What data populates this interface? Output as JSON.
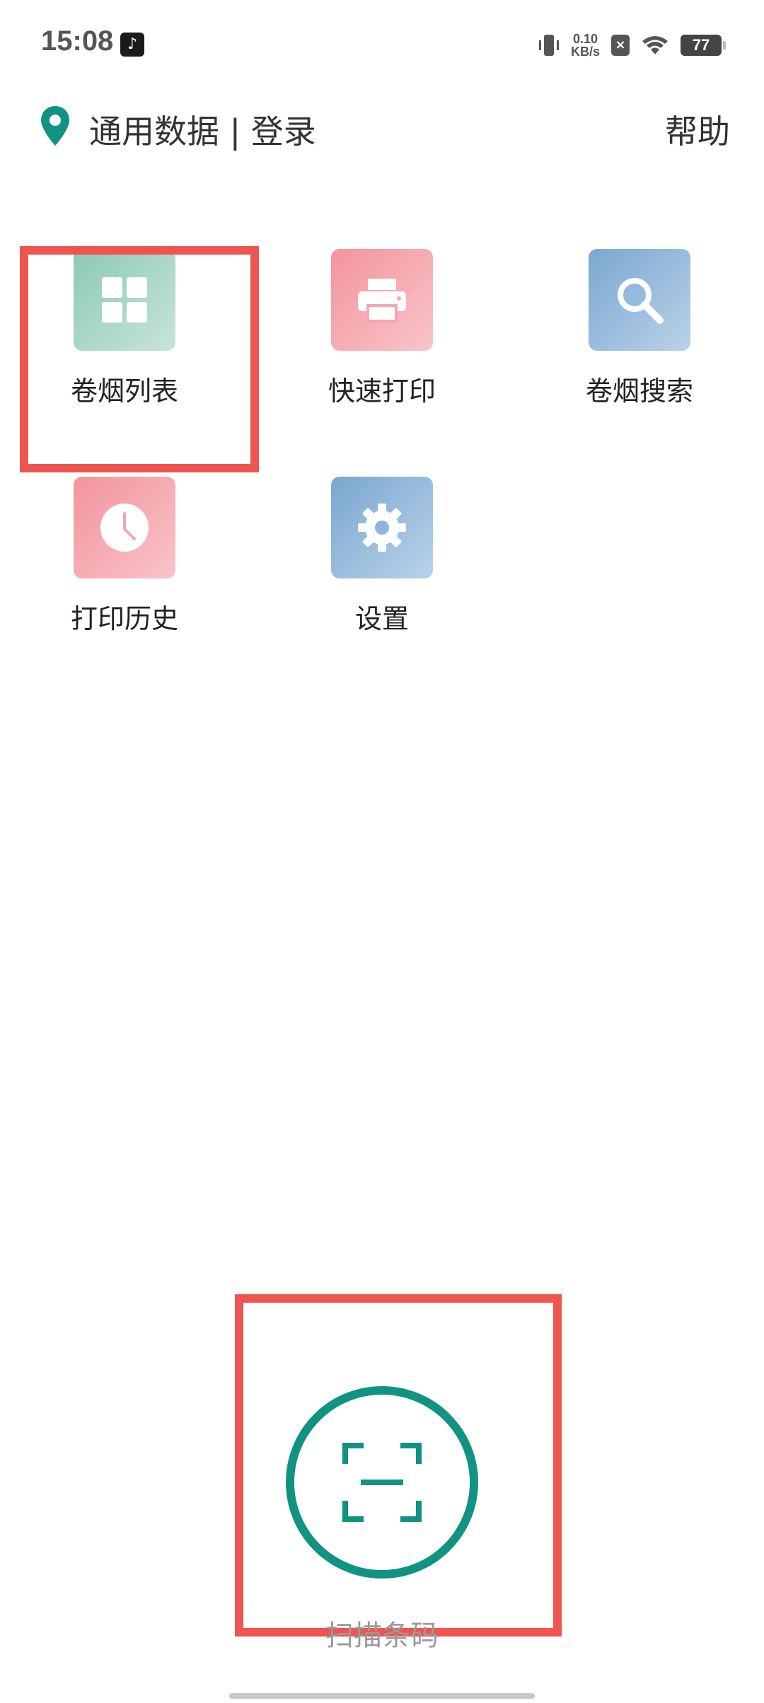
{
  "status_bar": {
    "time": "15:08",
    "tiktok_glyph": "♪",
    "net_speed_value": "0.10",
    "net_speed_unit": "KB/s",
    "sim_glyph": "×",
    "battery": "77"
  },
  "header": {
    "title": "通用数据 | 登录",
    "help": "帮助",
    "location_icon": "location-pin-icon",
    "accent_color": "#109382"
  },
  "grid": {
    "items": [
      {
        "label": "卷烟列表",
        "icon": "grid-icon",
        "color": "green"
      },
      {
        "label": "快速打印",
        "icon": "printer-icon",
        "color": "pink"
      },
      {
        "label": "卷烟搜索",
        "icon": "search-icon",
        "color": "blue"
      },
      {
        "label": "打印历史",
        "icon": "clock-icon",
        "color": "pink"
      },
      {
        "label": "设置",
        "icon": "gear-icon",
        "color": "blue"
      }
    ]
  },
  "scan": {
    "label": "扫描条码",
    "icon": "scan-barcode-icon",
    "color": "#109382"
  },
  "highlight_color": "#ef5550"
}
